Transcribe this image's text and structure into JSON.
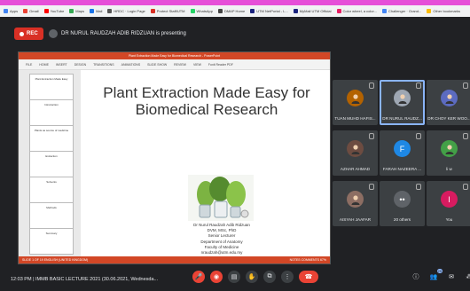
{
  "bookmarks": [
    {
      "label": "Apps",
      "color": "#4285f4"
    },
    {
      "label": "Gmail",
      "color": "#ea4335"
    },
    {
      "label": "YouTube",
      "color": "#ff0000"
    },
    {
      "label": "Maps",
      "color": "#34a853"
    },
    {
      "label": "Mail",
      "color": "#1a73e8"
    },
    {
      "label": "HRDC · Login Page",
      "color": "#555"
    },
    {
      "label": "Protect Staff/UTM",
      "color": "#d93025"
    },
    {
      "label": "WhatsApp",
      "color": "#25d366"
    },
    {
      "label": "DMAP Home",
      "color": "#444"
    },
    {
      "label": "UTM NetPortal - L...",
      "color": "#1a237e"
    },
    {
      "label": "MyMail UTM Official",
      "color": "#1a237e"
    },
    {
      "label": "Color wheel, a color...",
      "color": "#e91e63"
    },
    {
      "label": "Challenger · Grand...",
      "color": "#4285f4"
    },
    {
      "label": "Other bookmarks",
      "color": "#fbbc04"
    }
  ],
  "meet": {
    "rec_label": "REC",
    "presenter_text": "DR NURUL RAUDZAH ADIB RIDZUAN is presenting"
  },
  "ppt": {
    "window_title": "Plant Extraction Made Easy for Biomedical Research - PowerPoint",
    "ribbon_tabs": [
      "FILE",
      "HOME",
      "INSERT",
      "DESIGN",
      "TRANSITIONS",
      "ANIMATIONS",
      "SLIDE SHOW",
      "REVIEW",
      "VIEW",
      "Foxit Reader PDF"
    ],
    "thumbs": [
      {
        "n": "1",
        "text": "Plant Extraction Made Easy"
      },
      {
        "n": "2",
        "text": "Introduction"
      },
      {
        "n": "3",
        "text": "Plants as source of medicine"
      },
      {
        "n": "4",
        "text": "Extraction"
      },
      {
        "n": "5",
        "text": "Solvents"
      },
      {
        "n": "6",
        "text": "Methods"
      },
      {
        "n": "7",
        "text": "Summary"
      }
    ],
    "slide_title": "Plant Extraction Made Easy for Biomedical Research",
    "author_lines": [
      "Dr Nurul Raudzah Adib Ridzuan",
      "DVM, MSc, PhD",
      "Senior Lecturer",
      "Department of Anatomy",
      "Faculty of Medicine",
      "nraudzah@utm.edu.my"
    ],
    "status_left": "SLIDE 1 OF 19   ENGLISH (UNITED KINGDOM)",
    "status_right": "NOTES   COMMENTS   67%"
  },
  "participants": [
    {
      "name": "TUAN MUHD HAFIS...",
      "color": "#b36200",
      "kind": "photo",
      "initial": ""
    },
    {
      "name": "DR NURUL RAUDZ...",
      "color": "#9ea7b3",
      "kind": "photo",
      "initial": "",
      "active": true
    },
    {
      "name": "DR CHOY KER WOO...",
      "color": "#5c6bc0",
      "kind": "photo",
      "initial": ""
    },
    {
      "name": "AZHAR AHMAD",
      "color": "#6d4c41",
      "kind": "photo",
      "initial": ""
    },
    {
      "name": "FARAH NAZEERA ...",
      "color": "#1e88e5",
      "kind": "letter",
      "initial": "F"
    },
    {
      "name": "li w",
      "color": "#43a047",
      "kind": "photo",
      "initial": ""
    },
    {
      "name": "AISYAH JAAFAR",
      "color": "#8d6e63",
      "kind": "photo",
      "initial": ""
    },
    {
      "name": "20 others",
      "color": "#5f6368",
      "kind": "group",
      "initial": ""
    },
    {
      "name": "You",
      "color": "#d81b60",
      "kind": "letter",
      "initial": "I"
    }
  ],
  "footer": {
    "meeting_info": "12:03 PM  |  IMMB BASIC LECTURE 2021 (30.06.2021, Wednesda...",
    "participants_count": "29"
  }
}
